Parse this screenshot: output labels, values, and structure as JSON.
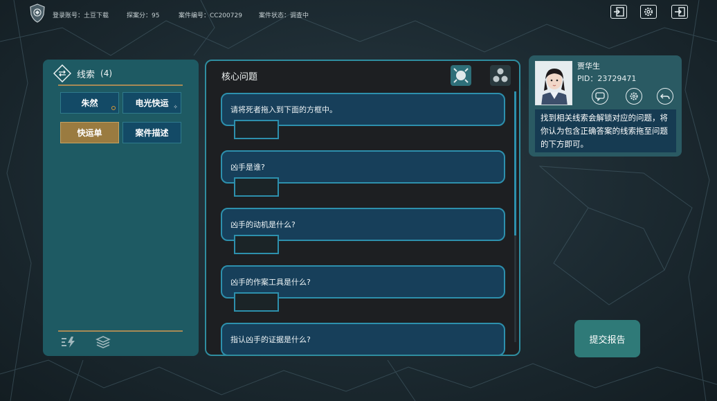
{
  "topbar": {
    "account": "登录账号：土豆下载",
    "score": "探案分：95",
    "case_no": "案件编号：CC200729",
    "case_status": "案件状态：调查中",
    "icons": [
      "import-icon",
      "settings-icon",
      "exit-icon"
    ]
  },
  "clues": {
    "title": "线索",
    "count": "(4)",
    "items": [
      {
        "label": "朱然",
        "badge": "dot"
      },
      {
        "label": "电光快运",
        "badge": "spark"
      },
      {
        "label": "快运单",
        "selected": true
      },
      {
        "label": "案件描述"
      }
    ]
  },
  "core": {
    "title": "核心问题",
    "questions": [
      "请将死者拖入到下面的方框中。",
      "凶手是谁?",
      "凶手的动机是什么?",
      "凶手的作案工具是什么?",
      "指认凶手的证据是什么?"
    ]
  },
  "detective": {
    "name": "贾华生",
    "pid": "PID：23729471",
    "hint": "找到相关线索会解锁对应的问题，将你认为包含正确答案的线索拖至问题的下方即可。"
  },
  "submit": {
    "label": "提交报告"
  },
  "colors": {
    "accent": "#2d90ad",
    "panel": "#1e5a63",
    "gold": "#a88a55",
    "selected": "#9a7b40"
  }
}
